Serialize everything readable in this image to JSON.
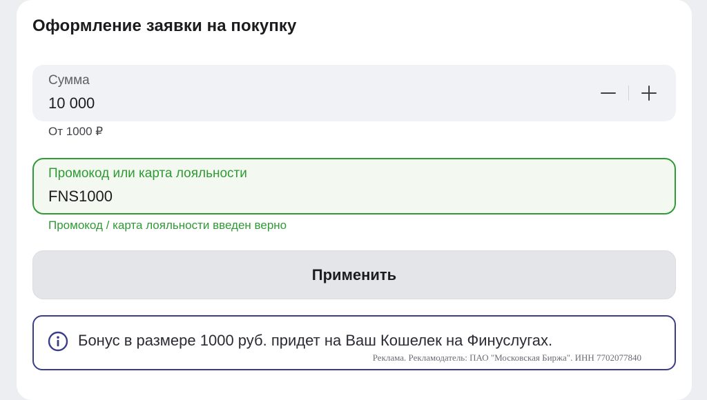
{
  "form": {
    "title": "Оформление заявки на покупку"
  },
  "amount": {
    "label": "Сумма",
    "value": "10 000",
    "hint": "От 1000 ₽",
    "decrement_icon": "minus-icon",
    "increment_icon": "plus-icon"
  },
  "promo": {
    "label": "Промокод или карта лояльности",
    "value": "FNS1000",
    "status": "Промокод / карта лояльности введен верно",
    "status_color": "#2f9a34"
  },
  "apply_button": {
    "label": "Применить"
  },
  "bonus": {
    "icon": "info-icon",
    "text": "Бонус в размере 1000 руб. придет на Ваш Кошелек на Финуслугах.",
    "ad_disclaimer": "Реклама. Рекламодатель: ПАО \"Московская Биржа\". ИНН 7702077840",
    "border_color": "#3a3c8c"
  }
}
